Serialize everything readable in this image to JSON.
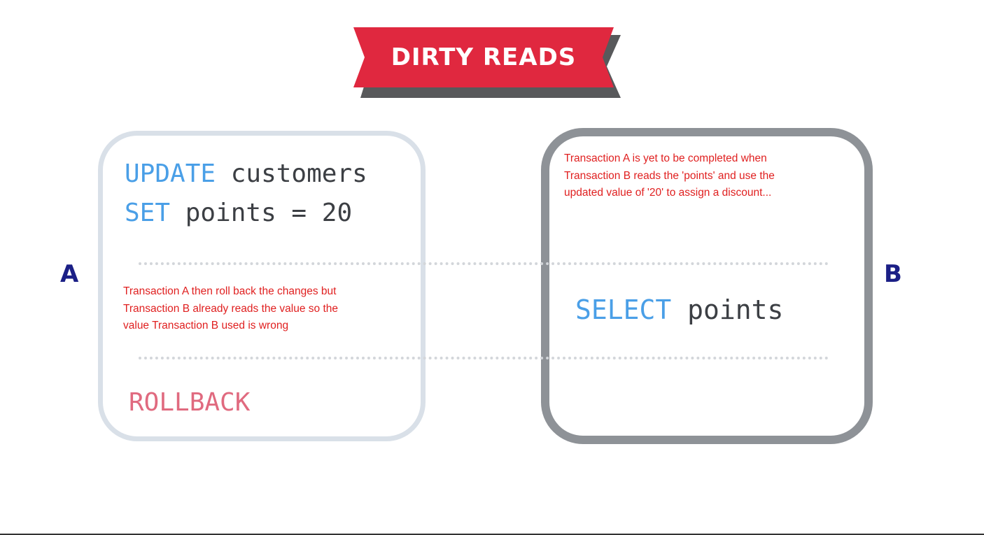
{
  "title": "DIRTY READS",
  "colors": {
    "banner": "#e0283f",
    "banner_shadow": "#58595b",
    "keyword": "#4a9fe7",
    "code": "#3c3f44",
    "rollback": "#e06a7f",
    "note": "#e02020",
    "side_label": "#1b1f86",
    "box_a_border": "#d9e0e8",
    "box_b_border": "#8e9297"
  },
  "transaction_a": {
    "label": "A",
    "line1": {
      "keyword": "UPDATE",
      "rest": " customers"
    },
    "line2": {
      "keyword": "SET",
      "rest": " points = 20"
    },
    "note_lines": [
      "Transaction A then roll back the changes but",
      "Transaction B already reads the value so the",
      "value Transaction B used is wrong"
    ],
    "rollback": "ROLLBACK"
  },
  "transaction_b": {
    "label": "B",
    "note_lines": [
      "Transaction A is yet to be completed when",
      "Transaction B reads the 'points' and use the",
      "updated value of '20' to assign a discount..."
    ],
    "line1": {
      "keyword": "SELECT",
      "rest": " points"
    }
  }
}
